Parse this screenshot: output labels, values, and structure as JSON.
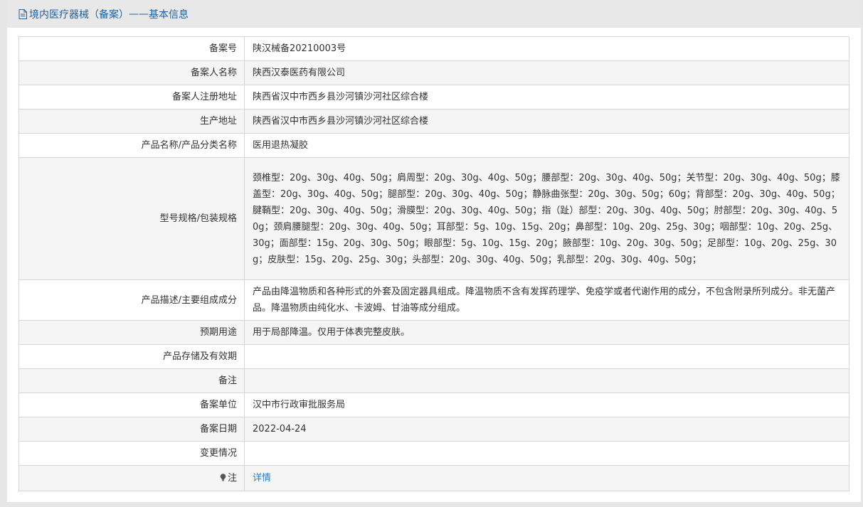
{
  "header": {
    "title": "境内医疗器械（备案）",
    "separator": " ——",
    "subtitle": "基本信息",
    "icon": "document-icon"
  },
  "rows": [
    {
      "label": "备案号",
      "value": "陕汉械备20210003号"
    },
    {
      "label": "备案人名称",
      "value": "陕西汉泰医药有限公司"
    },
    {
      "label": "备案人注册地址",
      "value": "陕西省汉中市西乡县沙河镇沙河社区综合楼"
    },
    {
      "label": "生产地址",
      "value": "陕西省汉中市西乡县沙河镇沙河社区综合楼"
    },
    {
      "label": "产品名称/产品分类名称",
      "value": "医用退热凝胶"
    },
    {
      "label": "型号规格/包装规格",
      "value": "颈椎型：20g、30g、40g、50g；肩周型：20g、30g、40g、50g；腰部型：20g、30g、40g、50g；关节型：20g、30g、40g、50g；膝盖型：20g、30g、40g、50g；腿部型：20g、30g、40g、50g；静脉曲张型：20g、30g、50g；60g；背部型：20g、30g、40g、50g；腱鞘型：20g、30g、40g、50g；滑膜型：20g、30g、40g、50g；指（趾）部型：20g、30g、40g、50g；肘部型：20g、30g、40g、50g；颈肩腰腿型：20g、30g、40g、50g；耳部型：5g、10g、15g、20g；鼻部型：10g、20g、25g、30g；咽部型：10g、20g、25g、30g；面部型：15g、20g、30g、50g；眼部型：5g、10g、15g、20g；腋部型：10g、20g、30g、50g；足部型：10g、20g、25g、30g；皮肤型：15g、20g、25g、30g；头部型：20g、30g、40g、50g；乳部型：20g、30g、40g、50g；"
    },
    {
      "label": "产品描述/主要组成成分",
      "value": "产品由降温物质和各种形式的外套及固定器具组成。降温物质不含有发挥药理学、免疫学或者代谢作用的成分，不包含附录所列成分。非无菌产品。降温物质由纯化水、卡波姆、甘油等成分组成。"
    },
    {
      "label": "预期用途",
      "value": "用于局部降温。仅用于体表完整皮肤。"
    },
    {
      "label": "产品存储及有效期",
      "value": ""
    },
    {
      "label": "备注",
      "value": ""
    },
    {
      "label": "备案单位",
      "value": "汉中市行政审批服务局"
    },
    {
      "label": "备案日期",
      "value": "2022-04-24"
    },
    {
      "label": "变更情况",
      "value": ""
    }
  ],
  "note_row": {
    "icon": "lightbulb-icon",
    "label": "注",
    "link_text": "详情"
  }
}
